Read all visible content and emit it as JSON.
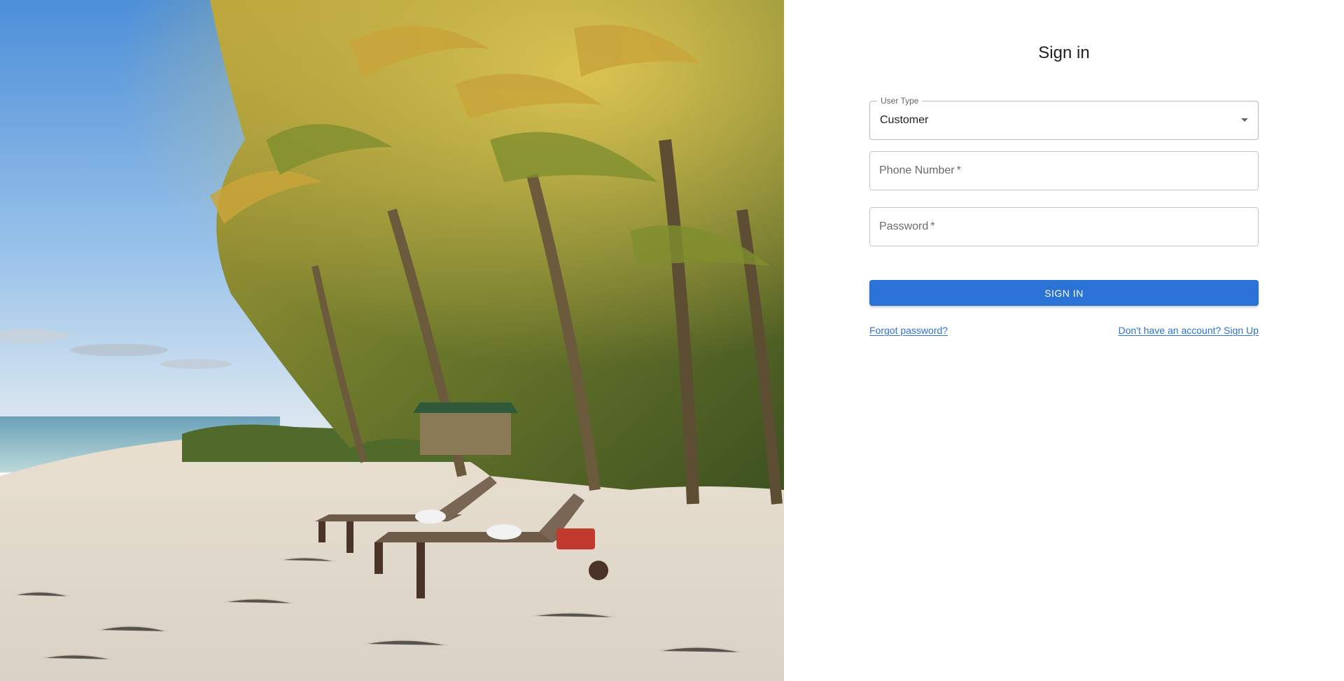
{
  "hero": {
    "alt": "Tropical beach with palm trees and two sun loungers"
  },
  "form": {
    "title": "Sign in",
    "user_type": {
      "label": "User Type",
      "value": "Customer"
    },
    "phone": {
      "label": "Phone Number",
      "required_mark": "*"
    },
    "password": {
      "label": "Password",
      "required_mark": "*"
    },
    "submit_label": "SIGN IN",
    "forgot_link": "Forgot password?",
    "signup_link": "Don't have an account? Sign Up"
  },
  "colors": {
    "primary": "#2a72d4",
    "border": "#c4c4c4",
    "text": "#1f1f1f",
    "muted": "#6b6b6b"
  }
}
